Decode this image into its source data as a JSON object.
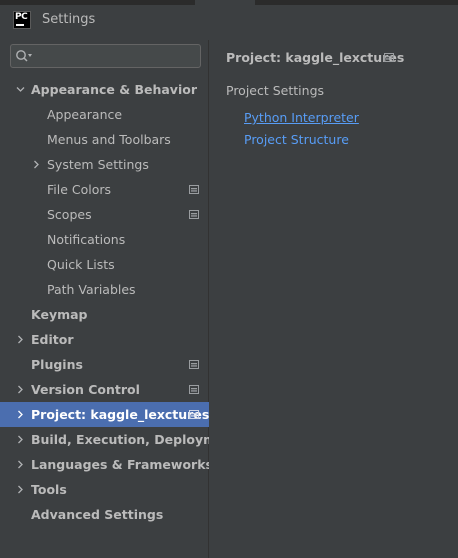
{
  "window": {
    "title": "Settings",
    "app_logo_text": "PC"
  },
  "search": {
    "value": "",
    "placeholder": "",
    "icon": "search-icon"
  },
  "sidebar": {
    "items": [
      {
        "label": "Appearance & Behavior",
        "level": 0,
        "expanded": true,
        "has_children": true,
        "bold": true,
        "project_icon": false,
        "selected": false
      },
      {
        "label": "Appearance",
        "level": 1,
        "has_children": false,
        "bold": false,
        "project_icon": false,
        "selected": false
      },
      {
        "label": "Menus and Toolbars",
        "level": 1,
        "has_children": false,
        "bold": false,
        "project_icon": false,
        "selected": false
      },
      {
        "label": "System Settings",
        "level": 1,
        "has_children": true,
        "expanded": false,
        "bold": false,
        "project_icon": false,
        "selected": false
      },
      {
        "label": "File Colors",
        "level": 1,
        "has_children": false,
        "bold": false,
        "project_icon": true,
        "selected": false
      },
      {
        "label": "Scopes",
        "level": 1,
        "has_children": false,
        "bold": false,
        "project_icon": true,
        "selected": false
      },
      {
        "label": "Notifications",
        "level": 1,
        "has_children": false,
        "bold": false,
        "project_icon": false,
        "selected": false
      },
      {
        "label": "Quick Lists",
        "level": 1,
        "has_children": false,
        "bold": false,
        "project_icon": false,
        "selected": false
      },
      {
        "label": "Path Variables",
        "level": 1,
        "has_children": false,
        "bold": false,
        "project_icon": false,
        "selected": false
      },
      {
        "label": "Keymap",
        "level": 0,
        "has_children": false,
        "bold": true,
        "project_icon": false,
        "selected": false
      },
      {
        "label": "Editor",
        "level": 0,
        "has_children": true,
        "expanded": false,
        "bold": true,
        "project_icon": false,
        "selected": false
      },
      {
        "label": "Plugins",
        "level": 0,
        "has_children": false,
        "bold": true,
        "project_icon": true,
        "selected": false
      },
      {
        "label": "Version Control",
        "level": 0,
        "has_children": true,
        "expanded": false,
        "bold": true,
        "project_icon": true,
        "selected": false
      },
      {
        "label": "Project: kaggle_lexctures",
        "level": 0,
        "has_children": true,
        "expanded": false,
        "bold": true,
        "project_icon": true,
        "selected": true
      },
      {
        "label": "Build, Execution, Deployment",
        "level": 0,
        "has_children": true,
        "expanded": false,
        "bold": true,
        "project_icon": false,
        "selected": false
      },
      {
        "label": "Languages & Frameworks",
        "level": 0,
        "has_children": true,
        "expanded": false,
        "bold": true,
        "project_icon": false,
        "selected": false
      },
      {
        "label": "Tools",
        "level": 0,
        "has_children": true,
        "expanded": false,
        "bold": true,
        "project_icon": false,
        "selected": false
      },
      {
        "label": "Advanced Settings",
        "level": 0,
        "has_children": false,
        "bold": true,
        "project_icon": false,
        "selected": false
      }
    ]
  },
  "main": {
    "title": "Project: kaggle_lexctures",
    "section_label": "Project Settings",
    "links": [
      {
        "label": "Python Interpreter",
        "underlined": true
      },
      {
        "label": "Project Structure",
        "underlined": false
      }
    ]
  },
  "colors": {
    "background": "#3c3f41",
    "selection": "#4b6eaf",
    "link": "#589df6",
    "text": "#bbbbbb"
  }
}
